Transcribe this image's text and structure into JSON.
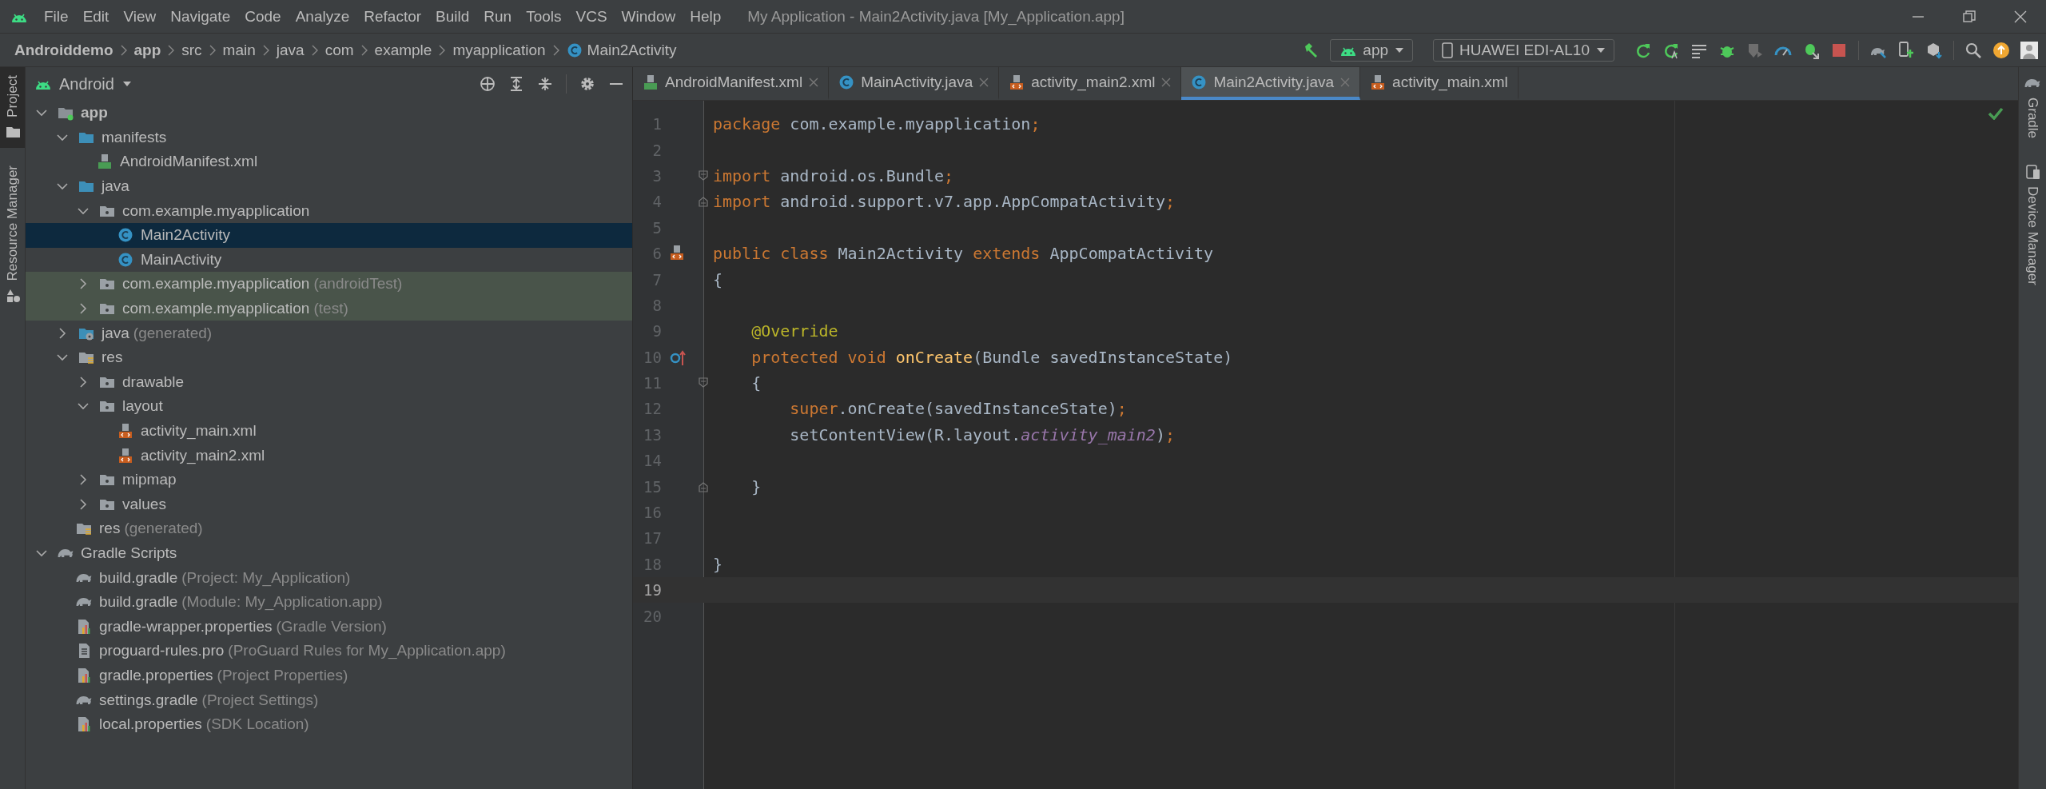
{
  "window": {
    "title": "My Application - Main2Activity.java [My_Application.app]"
  },
  "menu": [
    "File",
    "Edit",
    "View",
    "Navigate",
    "Code",
    "Analyze",
    "Refactor",
    "Build",
    "Run",
    "Tools",
    "VCS",
    "Window",
    "Help"
  ],
  "breadcrumbs": [
    {
      "label": "Androiddemo",
      "bold": true,
      "kind": "plain"
    },
    {
      "label": "app",
      "bold": true,
      "kind": "plain"
    },
    {
      "label": "src",
      "bold": false,
      "kind": "plain"
    },
    {
      "label": "main",
      "bold": false,
      "kind": "plain"
    },
    {
      "label": "java",
      "bold": false,
      "kind": "plain"
    },
    {
      "label": "com",
      "bold": false,
      "kind": "plain"
    },
    {
      "label": "example",
      "bold": false,
      "kind": "plain"
    },
    {
      "label": "myapplication",
      "bold": false,
      "kind": "plain"
    },
    {
      "label": "Main2Activity",
      "bold": false,
      "kind": "class"
    }
  ],
  "toolbar": {
    "run_config": "app",
    "device": "HUAWEI EDI-AL10"
  },
  "left_stripe": [
    {
      "label": "Project",
      "selected": true,
      "kind": "folder"
    },
    {
      "label": "Resource Manager",
      "selected": false,
      "kind": "shapes"
    }
  ],
  "right_stripe": [
    {
      "label": "Gradle",
      "kind": "gradle"
    },
    {
      "label": "Device Manager",
      "kind": "device"
    }
  ],
  "project": {
    "view": "Android",
    "tree": [
      {
        "label": "app",
        "kind": "module",
        "expanded": true,
        "selected": false,
        "tests": false,
        "children": [
          {
            "label": "manifests",
            "kind": "folder",
            "expanded": true,
            "selected": false,
            "tests": false,
            "children": [
              {
                "label": "AndroidManifest.xml",
                "kind": "manifest",
                "selected": false,
                "tests": false
              }
            ]
          },
          {
            "label": "java",
            "kind": "folder",
            "expanded": true,
            "selected": false,
            "tests": false,
            "children": [
              {
                "label": "com.example.myapplication",
                "kind": "package",
                "expanded": true,
                "selected": false,
                "tests": false,
                "children": [
                  {
                    "label": "Main2Activity",
                    "kind": "class",
                    "selected": true,
                    "tests": false
                  },
                  {
                    "label": "MainActivity",
                    "kind": "class",
                    "selected": false,
                    "tests": false
                  }
                ]
              },
              {
                "label": "com.example.myapplication",
                "hint": "(androidTest)",
                "kind": "package",
                "expanded": false,
                "selected": false,
                "tests": true
              },
              {
                "label": "com.example.myapplication",
                "hint": "(test)",
                "kind": "package",
                "expanded": false,
                "selected": false,
                "tests": true
              }
            ]
          },
          {
            "label": "java",
            "hint": "(generated)",
            "kind": "generated",
            "expanded": false,
            "selected": false,
            "tests": false
          },
          {
            "label": "res",
            "kind": "res",
            "expanded": true,
            "selected": false,
            "tests": false,
            "children": [
              {
                "label": "drawable",
                "kind": "package",
                "expanded": false,
                "selected": false,
                "tests": false
              },
              {
                "label": "layout",
                "kind": "package",
                "expanded": true,
                "selected": false,
                "tests": false,
                "children": [
                  {
                    "label": "activity_main.xml",
                    "kind": "layout",
                    "selected": false,
                    "tests": false
                  },
                  {
                    "label": "activity_main2.xml",
                    "kind": "layout",
                    "selected": false,
                    "tests": false
                  }
                ]
              },
              {
                "label": "mipmap",
                "kind": "package",
                "expanded": false,
                "selected": false,
                "tests": false
              },
              {
                "label": "values",
                "kind": "package",
                "expanded": false,
                "selected": false,
                "tests": false
              }
            ]
          },
          {
            "label": "res",
            "hint": "(generated)",
            "kind": "res",
            "selected": false,
            "tests": false
          }
        ]
      },
      {
        "label": "Gradle Scripts",
        "kind": "gradle",
        "expanded": true,
        "selected": false,
        "tests": false,
        "children": [
          {
            "label": "build.gradle",
            "hint": "(Project: My_Application)",
            "kind": "gradle",
            "selected": false,
            "tests": false
          },
          {
            "label": "build.gradle",
            "hint": "(Module: My_Application.app)",
            "kind": "gradle",
            "selected": false,
            "tests": false
          },
          {
            "label": "gradle-wrapper.properties",
            "hint": "(Gradle Version)",
            "kind": "properties",
            "selected": false,
            "tests": false
          },
          {
            "label": "proguard-rules.pro",
            "hint": "(ProGuard Rules for My_Application.app)",
            "kind": "file",
            "selected": false,
            "tests": false
          },
          {
            "label": "gradle.properties",
            "hint": "(Project Properties)",
            "kind": "properties",
            "selected": false,
            "tests": false
          },
          {
            "label": "settings.gradle",
            "hint": "(Project Settings)",
            "kind": "gradle",
            "selected": false,
            "tests": false
          },
          {
            "label": "local.properties",
            "hint": "(SDK Location)",
            "kind": "properties",
            "selected": false,
            "tests": false
          }
        ]
      }
    ]
  },
  "editor": {
    "tabs": [
      {
        "label": "AndroidManifest.xml",
        "kind": "manifest",
        "selected": false
      },
      {
        "label": "MainActivity.java",
        "kind": "class",
        "selected": false
      },
      {
        "label": "activity_main2.xml",
        "kind": "layout",
        "selected": false
      },
      {
        "label": "Main2Activity.java",
        "kind": "class",
        "selected": true
      },
      {
        "label": "activity_main.xml",
        "kind": "layout",
        "selected": false
      }
    ],
    "lines": [
      {
        "number": "1",
        "current": false,
        "kind": "plain",
        "tokens": [
          {
            "text": "package",
            "kind": "keyword"
          },
          {
            "text": " com.example.myapplication",
            "kind": "plain"
          },
          {
            "text": ";",
            "kind": "keyword"
          }
        ]
      },
      {
        "number": "2",
        "current": false,
        "kind": "plain"
      },
      {
        "number": "3",
        "current": false,
        "kind": "foldstart",
        "tokens": [
          {
            "text": "import",
            "kind": "keyword"
          },
          {
            "text": " android.os.Bundle",
            "kind": "plain"
          },
          {
            "text": ";",
            "kind": "keyword"
          }
        ]
      },
      {
        "number": "4",
        "current": false,
        "kind": "foldend",
        "tokens": [
          {
            "text": "import",
            "kind": "keyword"
          },
          {
            "text": " android.support.v7.app.AppCompatActivity",
            "kind": "plain"
          },
          {
            "text": ";",
            "kind": "keyword"
          }
        ]
      },
      {
        "number": "5",
        "current": false,
        "kind": "plain"
      },
      {
        "number": "6",
        "current": false,
        "kind": "layout",
        "tokens": [
          {
            "text": "public class",
            "kind": "keyword"
          },
          {
            "text": " Main2Activity ",
            "kind": "plain"
          },
          {
            "text": "extends",
            "kind": "keyword"
          },
          {
            "text": " AppCompatActivity",
            "kind": "plain"
          }
        ]
      },
      {
        "number": "7",
        "current": false,
        "kind": "plain",
        "tokens": [
          {
            "text": "{",
            "kind": "plain"
          }
        ]
      },
      {
        "number": "8",
        "current": false,
        "kind": "plain"
      },
      {
        "number": "9",
        "current": false,
        "kind": "plain",
        "tokens": [
          {
            "text": "    @Override",
            "kind": "annotation"
          }
        ]
      },
      {
        "number": "10",
        "current": false,
        "kind": "override",
        "tokens": [
          {
            "text": "    protected void",
            "kind": "keyword"
          },
          {
            "text": " onCreate",
            "kind": "method"
          },
          {
            "text": "(Bundle savedInstanceState)",
            "kind": "plain"
          }
        ]
      },
      {
        "number": "11",
        "current": false,
        "kind": "foldstart",
        "tokens": [
          {
            "text": "    {",
            "kind": "plain"
          }
        ]
      },
      {
        "number": "12",
        "current": false,
        "kind": "plain",
        "tokens": [
          {
            "text": "        super",
            "kind": "keyword"
          },
          {
            "text": ".onCreate(savedInstanceState)",
            "kind": "plain"
          },
          {
            "text": ";",
            "kind": "keyword"
          }
        ]
      },
      {
        "number": "13",
        "current": false,
        "kind": "plain",
        "tokens": [
          {
            "text": "        setContentView(R.layout.",
            "kind": "plain"
          },
          {
            "text": "activity_main2",
            "kind": "field"
          },
          {
            "text": ")",
            "kind": "plain"
          },
          {
            "text": ";",
            "kind": "keyword"
          }
        ]
      },
      {
        "number": "14",
        "current": false,
        "kind": "plain"
      },
      {
        "number": "15",
        "current": false,
        "kind": "foldend",
        "tokens": [
          {
            "text": "    }",
            "kind": "plain"
          }
        ]
      },
      {
        "number": "16",
        "current": false,
        "kind": "plain"
      },
      {
        "number": "17",
        "current": false,
        "kind": "plain"
      },
      {
        "number": "18",
        "current": false,
        "kind": "plain",
        "tokens": [
          {
            "text": "}",
            "kind": "plain"
          }
        ]
      },
      {
        "number": "19",
        "current": true,
        "kind": "plain"
      },
      {
        "number": "20",
        "current": false,
        "kind": "plain"
      }
    ]
  }
}
